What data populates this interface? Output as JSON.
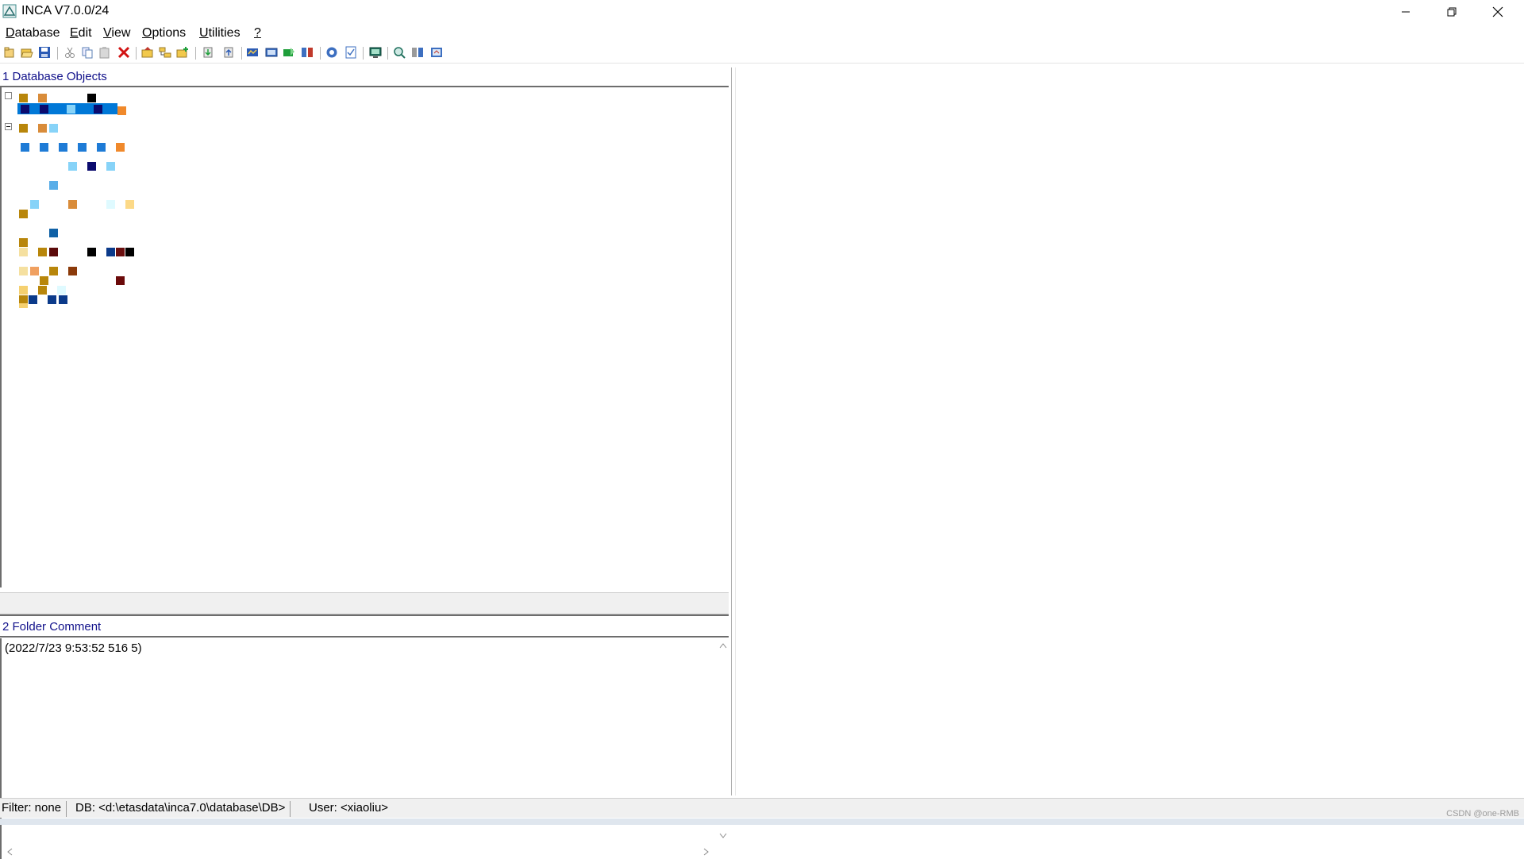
{
  "window": {
    "title": "INCA V7.0.0/24",
    "controls": [
      "minimize-icon",
      "restore-icon",
      "close-icon"
    ]
  },
  "menu": [
    {
      "label": "Database",
      "accel": "D"
    },
    {
      "label": "Edit",
      "accel": "E"
    },
    {
      "label": "View",
      "accel": "V"
    },
    {
      "label": "Options",
      "accel": "O"
    },
    {
      "label": "Utilities",
      "accel": "U"
    },
    {
      "label": "?",
      "accel": "?"
    }
  ],
  "toolbar": {
    "icons": [
      "new-folder-icon",
      "open-folder-icon",
      "save-icon",
      "cut-icon",
      "copy-icon",
      "paste-icon",
      "delete-icon",
      "folder-up-icon",
      "folder-tree-icon",
      "folder-add-icon",
      "import-icon",
      "export-icon",
      "experiment-icon",
      "workspace-icon",
      "hardware-icon",
      "compare-icon",
      "help-icon",
      "checklist-icon",
      "monitor-icon",
      "search-icon",
      "config-icon",
      "properties-icon"
    ]
  },
  "panels": {
    "database_objects": {
      "title": "1 Database Objects"
    },
    "folder_comment": {
      "title": "2 Folder Comment",
      "text": "(2022/7/23 9:53:52 516 5)"
    }
  },
  "status": {
    "filter": "Filter: none",
    "db": "DB: <d:\\etasdata\\inca7.0\\database\\DB>",
    "user": "User: <xiaoliu>"
  },
  "watermark": "CSDN @one-RMB",
  "colors": {
    "section_title": "#10108a",
    "selection": "#0078d7",
    "panel_rule": "#6d6d6d",
    "delete_red": "#d21414"
  }
}
